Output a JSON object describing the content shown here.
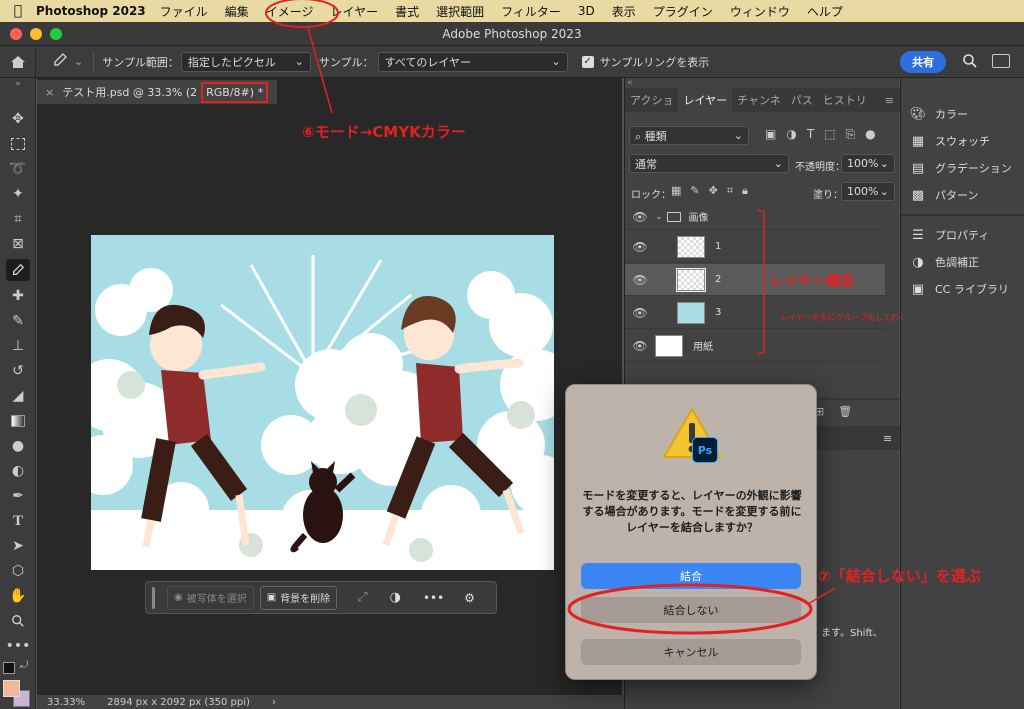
{
  "menubar": {
    "app": "Photoshop 2023",
    "items": [
      "ファイル",
      "編集",
      "イメージ",
      "レイヤー",
      "書式",
      "選択範囲",
      "フィルター",
      "3D",
      "表示",
      "プラグイン",
      "ウィンドウ",
      "ヘルプ"
    ]
  },
  "window": {
    "title": "Adobe Photoshop 2023"
  },
  "options": {
    "sample_range_label": "サンプル範囲：",
    "sample_range_value": "指定したピクセル",
    "sample_label": "サンプル：",
    "sample_value": "すべてのレイヤー",
    "ring_label": "サンプルリングを表示",
    "share": "共有"
  },
  "document": {
    "tab_title": "テスト用.psd @ 33.3% (2",
    "mode": "RGB/8#) *",
    "zoom": "33.33%",
    "size": "2894 px x 2092 px (350 ppi)"
  },
  "taskbar": {
    "select_subject": "被写体を選択",
    "remove_bg": "背景を削除"
  },
  "layers_panel": {
    "tabs": [
      "アクショ",
      "レイヤー",
      "チャンネ",
      "パス",
      "ヒストリ"
    ],
    "filter": "種類",
    "blend": "通常",
    "opacity_label": "不透明度：",
    "opacity": "100%",
    "lock_label": "ロック：",
    "fill_label": "塗り：",
    "fill": "100%",
    "layers": [
      {
        "name": "画像",
        "type": "group"
      },
      {
        "name": "1",
        "type": "layer"
      },
      {
        "name": "2",
        "type": "layer"
      },
      {
        "name": "3",
        "type": "layer"
      },
      {
        "name": "用紙",
        "type": "layer"
      }
    ],
    "peek_text": "ます。Shift、"
  },
  "right_panel": {
    "items": [
      "カラー",
      "スウォッチ",
      "グラデーション",
      "パターン",
      "プロパティ",
      "色調補正",
      "CC ライブラリ"
    ]
  },
  "dialog": {
    "message": "モードを変更すると、レイヤーの外観に影響する場合があります。モードを変更する前にレイヤーを結合しますか？",
    "badge": "Ps",
    "merge": "結合",
    "dont_merge": "結合しない",
    "cancel": "キャンセル"
  },
  "annotations": {
    "step6": "⑥モード→CMYKカラー",
    "layers_note": "レイヤー構造",
    "layers_sub": "レイヤーを先にグループ化しておく",
    "step7": "⑦「結合しない」を選ぶ"
  },
  "colors": {
    "accent": "#2e6fe0",
    "annotation": "#e02222",
    "menubar": "#e9d9a3",
    "sky": "#a8dde6",
    "shirt": "#8e2c2c"
  }
}
